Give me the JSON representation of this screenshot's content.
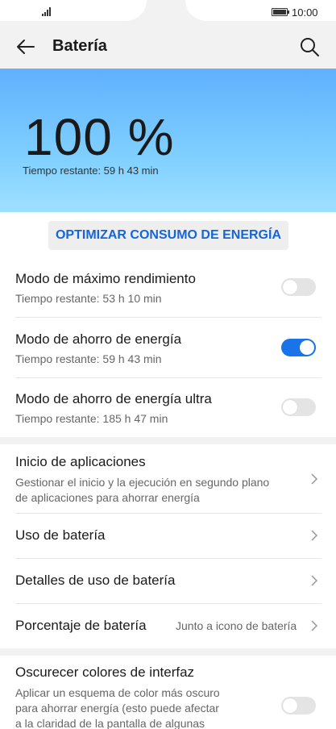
{
  "status": {
    "time": "10:00"
  },
  "header": {
    "title": "Batería"
  },
  "hero": {
    "percent": "100 %",
    "remaining": "Tiempo restante: 59 h 43 min"
  },
  "optimize_label": "OPTIMIZAR CONSUMO DE ENERGÍA",
  "modes": [
    {
      "title": "Modo de máximo rendimiento",
      "subtitle": "Tiempo restante: 53 h 10 min",
      "on": false
    },
    {
      "title": "Modo de ahorro de energía",
      "subtitle": "Tiempo restante: 59 h 43 min",
      "on": true
    },
    {
      "title": "Modo de ahorro de energía ultra",
      "subtitle": "Tiempo restante: 185 h 47 min",
      "on": false
    }
  ],
  "app_launch": {
    "title": "Inicio de aplicaciones",
    "desc_line1": "Gestionar el inicio y la ejecución en segundo plano",
    "desc_line2": "de aplicaciones para ahorrar energía"
  },
  "battery_usage": "Uso de batería",
  "battery_usage_details": "Detalles de uso de batería",
  "battery_percentage": {
    "title": "Porcentaje de batería",
    "value": "Junto a icono de batería"
  },
  "darken": {
    "title": "Oscurecer colores de interfaz",
    "desc_line1": "Aplicar un esquema de color más oscuro",
    "desc_line2": "para ahorrar energía (esto puede afectar",
    "desc_line3": "a la claridad de la pantalla de algunas",
    "on": false
  }
}
